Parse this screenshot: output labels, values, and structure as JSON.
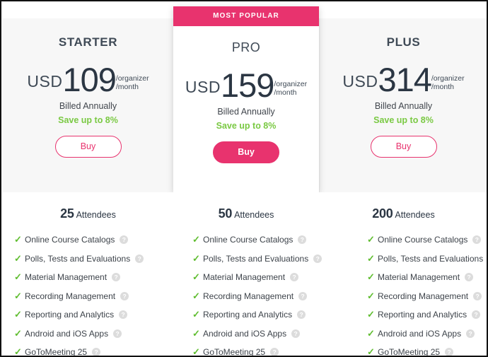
{
  "featured_ribbon_label": "MOST POPULAR",
  "colors": {
    "accent_pink": "#e8336e",
    "save_green": "#7ac943",
    "check_green": "#5fbd2f",
    "band_background": "#f7f7f7",
    "text_dark": "#2b3643"
  },
  "attendees_label": "Attendees",
  "plans": [
    {
      "name": "STARTER",
      "currency": "USD",
      "amount": "109",
      "per_line1": "/organizer",
      "per_line2": "/month",
      "billed": "Billed Annually",
      "save": "Save up to 8%",
      "buy_label": "Buy",
      "featured": false,
      "attendees_count": "25",
      "features": [
        "Online Course Catalogs",
        "Polls, Tests and Evaluations",
        "Material Management",
        "Recording Management",
        "Reporting and Analytics",
        "Android and iOS Apps",
        "GoToMeeting 25"
      ]
    },
    {
      "name": "PRO",
      "currency": "USD",
      "amount": "159",
      "per_line1": "/organizer",
      "per_line2": "/month",
      "billed": "Billed Annually",
      "save": "Save up to 8%",
      "buy_label": "Buy",
      "featured": true,
      "attendees_count": "50",
      "features": [
        "Online Course Catalogs",
        "Polls, Tests and Evaluations",
        "Material Management",
        "Recording Management",
        "Reporting and Analytics",
        "Android and iOS Apps",
        "GoToMeeting 25"
      ]
    },
    {
      "name": "PLUS",
      "currency": "USD",
      "amount": "314",
      "per_line1": "/organizer",
      "per_line2": "/month",
      "billed": "Billed Annually",
      "save": "Save up to 8%",
      "buy_label": "Buy",
      "featured": false,
      "attendees_count": "200",
      "features": [
        "Online Course Catalogs",
        "Polls, Tests and Evaluations",
        "Material Management",
        "Recording Management",
        "Reporting and Analytics",
        "Android and iOS Apps",
        "GoToMeeting 25"
      ]
    }
  ],
  "icons": {
    "check": "✓",
    "help": "?"
  }
}
